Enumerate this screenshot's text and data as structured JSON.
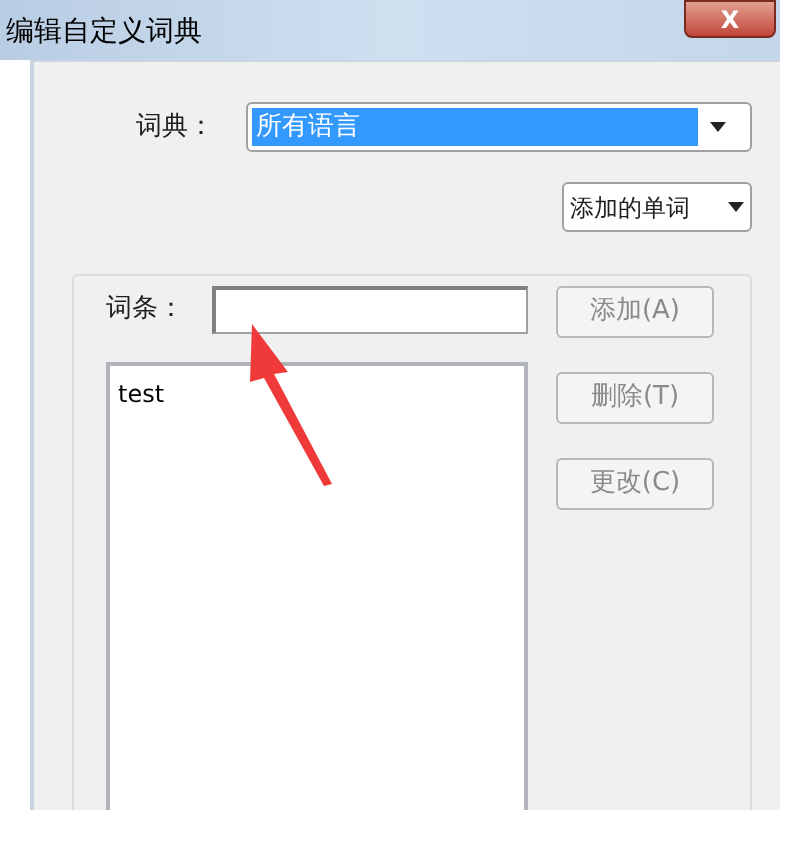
{
  "window": {
    "title": "编辑自定义词典",
    "close": "X"
  },
  "dictionary": {
    "label": "词典：",
    "value": "所有语言",
    "highlighted": true
  },
  "filter": {
    "value": "添加的单词"
  },
  "entry": {
    "label": "词条："
  },
  "buttons": [
    {
      "label": "添加(A)",
      "disabled": true
    },
    {
      "label": "删除(T)",
      "disabled": true
    },
    {
      "label": "更改(C)",
      "disabled": true
    }
  ],
  "words": [
    {
      "text": "test",
      "selected": false
    }
  ]
}
